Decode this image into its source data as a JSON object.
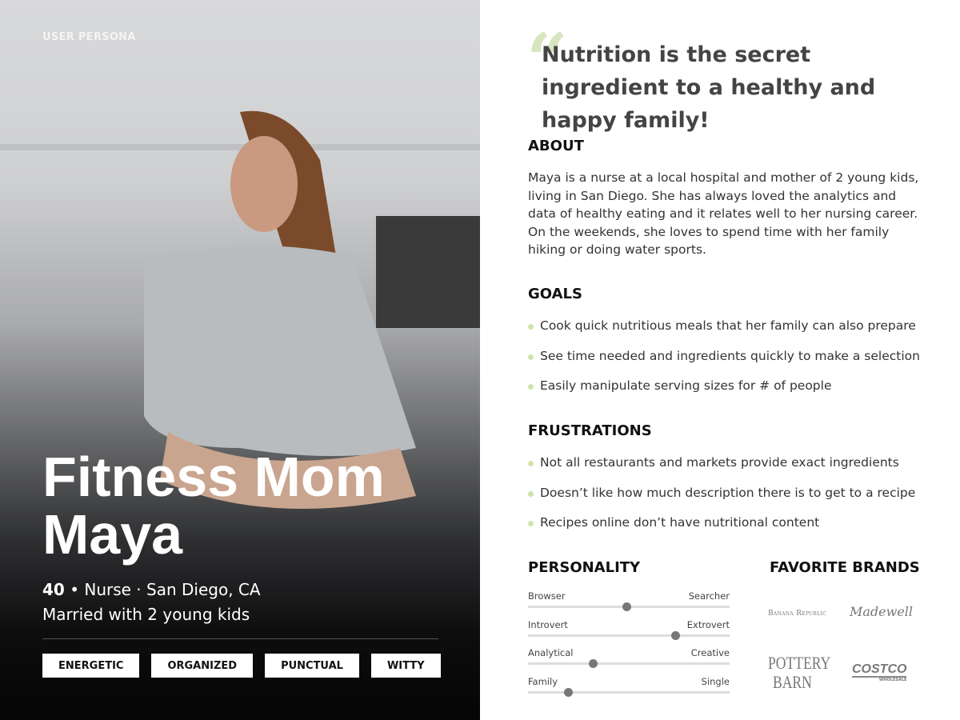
{
  "hero": {
    "label": "USER PERSONA",
    "name_line1": "Fitness Mom",
    "name_line2": "Maya",
    "age": "40",
    "details": " • Nurse · San Diego, CA",
    "family": "Married with 2 young kids",
    "traits": [
      "ENERGETIC",
      "ORGANIZED",
      "PUNCTUAL",
      "WITTY"
    ]
  },
  "quote": {
    "mark": "“",
    "text": "Nutrition is the secret ingredient to a healthy and happy family!"
  },
  "about": {
    "heading": "ABOUT",
    "text": "Maya is a nurse at a local hospital and mother of 2 young kids, living in San Diego. She has always loved the analytics and data of healthy eating and it relates well to her nursing career. On the weekends, she loves to spend time with her family hiking or doing water sports."
  },
  "goals": {
    "heading": "GOALS",
    "items": [
      "Cook quick nutritious meals that her family can also prepare",
      " See time needed and ingredients quickly to make a selection",
      "Easily manipulate serving sizes for # of people"
    ]
  },
  "frustrations": {
    "heading": "FRUSTRATIONS",
    "items": [
      "Not all restaurants and markets provide exact ingredients",
      "Doesn’t like how much description there is to get to a recipe",
      "Recipes online don’t have nutritional content"
    ]
  },
  "personality": {
    "heading": "PERSONALITY",
    "sliders": [
      {
        "left": "Browser",
        "right": "Searcher",
        "value": 0.49
      },
      {
        "left": "Introvert",
        "right": "Extrovert",
        "value": 0.73
      },
      {
        "left": "Analytical",
        "right": "Creative",
        "value": 0.32
      },
      {
        "left": "Family",
        "right": "Single",
        "value": 0.2
      }
    ]
  },
  "brands": {
    "heading": "FAVORITE BRANDS",
    "items": [
      "Banana Republic",
      "Madewell",
      "POTTERY BARN",
      "COSTCO",
      "WHOLESALE"
    ]
  },
  "colors": {
    "accent": "#cfe3ad",
    "quote_mark": "#d7e6bf"
  }
}
